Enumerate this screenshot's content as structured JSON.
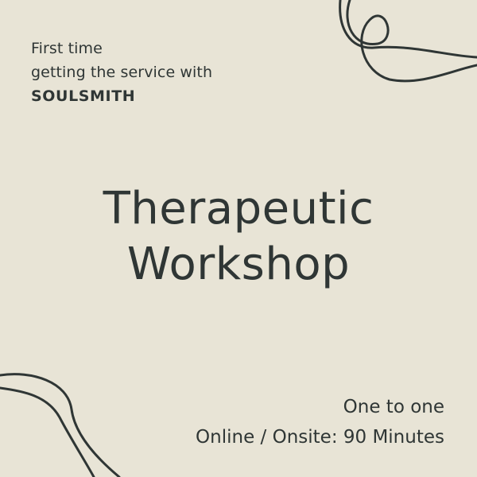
{
  "intro": {
    "line1": "First time",
    "line2": "getting the service with",
    "brand": "SOULSMITH"
  },
  "title": {
    "line1": "Therapeutic",
    "line2": "Workshop"
  },
  "details": {
    "format": "One to one",
    "mode_duration": "Online / Onsite: 90 Minutes"
  },
  "colors": {
    "background": "#e8e4d6",
    "ink": "#2f3635"
  }
}
